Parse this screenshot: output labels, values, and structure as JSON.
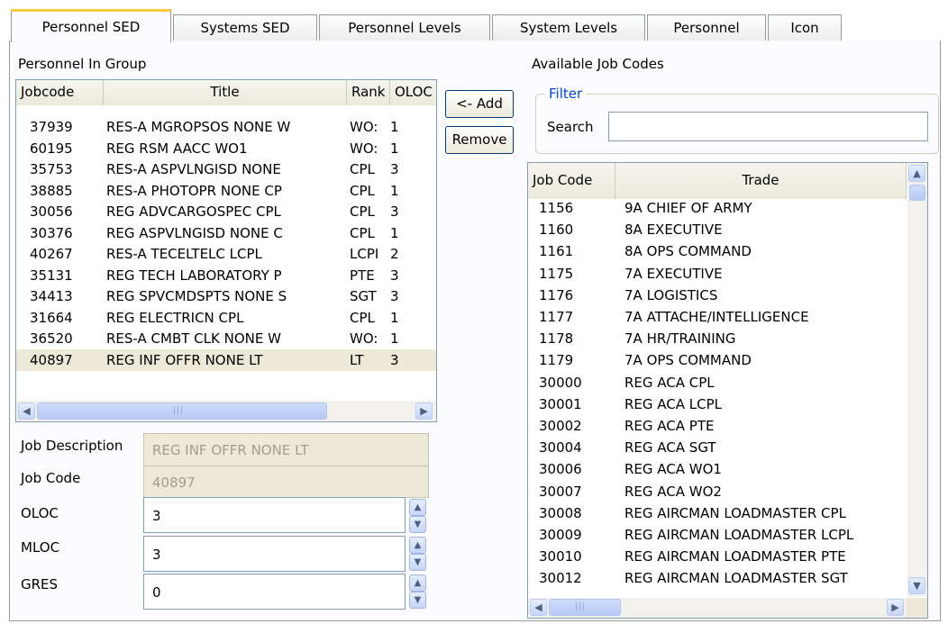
{
  "tabs": [
    {
      "label": "Personnel SED"
    },
    {
      "label": "Systems SED"
    },
    {
      "label": "Personnel Levels"
    },
    {
      "label": "System Levels"
    },
    {
      "label": "Personnel"
    },
    {
      "label": "Icon"
    }
  ],
  "personnel_group": {
    "label": "Personnel In Group",
    "columns": {
      "jobcode": "Jobcode",
      "title": "Title",
      "rank": "Rank",
      "oloc": "OLOC"
    },
    "rows": [
      {
        "jobcode": "37939",
        "title": "RES-A MGROPSOS NONE W",
        "rank": "WO:",
        "oloc": "1"
      },
      {
        "jobcode": "60195",
        "title": "REG RSM AACC WO1",
        "rank": "WO:",
        "oloc": "1"
      },
      {
        "jobcode": "35753",
        "title": "RES-A ASPVLNGISD NONE",
        "rank": "CPL",
        "oloc": "3"
      },
      {
        "jobcode": "38885",
        "title": "RES-A PHOTOPR NONE CP",
        "rank": "CPL",
        "oloc": "1"
      },
      {
        "jobcode": "30056",
        "title": "REG ADVCARGOSPEC CPL",
        "rank": "CPL",
        "oloc": "3"
      },
      {
        "jobcode": "30376",
        "title": "REG ASPVLNGISD NONE C",
        "rank": "CPL",
        "oloc": "1"
      },
      {
        "jobcode": "40267",
        "title": "RES-A TECELTELC LCPL",
        "rank": "LCPI",
        "oloc": "2"
      },
      {
        "jobcode": "35131",
        "title": "REG TECH LABORATORY P",
        "rank": "PTE",
        "oloc": "3"
      },
      {
        "jobcode": "34413",
        "title": "REG SPVCMDSPTS NONE S",
        "rank": "SGT",
        "oloc": "3"
      },
      {
        "jobcode": "31664",
        "title": "REG ELECTRICN CPL",
        "rank": "CPL",
        "oloc": "1"
      },
      {
        "jobcode": "36520",
        "title": "RES-A CMBT CLK NONE W",
        "rank": "WO:",
        "oloc": "1"
      },
      {
        "jobcode": "40897",
        "title": "REG INF OFFR NONE LT",
        "rank": "LT",
        "oloc": "3"
      }
    ],
    "selected_index": 11
  },
  "buttons": {
    "add": "<- Add",
    "remove": "Remove"
  },
  "details": {
    "job_description": {
      "label": "Job Description",
      "value": "REG INF OFFR NONE LT"
    },
    "job_code": {
      "label": "Job Code",
      "value": "40897"
    },
    "oloc": {
      "label": "OLOC",
      "value": "3"
    },
    "mloc": {
      "label": "MLOC",
      "value": "3"
    },
    "gres": {
      "label": "GRES",
      "value": "0"
    }
  },
  "available": {
    "label": "Available Job Codes",
    "filter": {
      "legend": "Filter",
      "search_label": "Search",
      "search_value": ""
    },
    "columns": {
      "job_code": "Job Code",
      "trade": "Trade"
    },
    "rows": [
      {
        "job_code": "1156",
        "trade": "9A CHIEF OF ARMY"
      },
      {
        "job_code": "1160",
        "trade": "8A EXECUTIVE"
      },
      {
        "job_code": "1161",
        "trade": "8A OPS COMMAND"
      },
      {
        "job_code": "1175",
        "trade": "7A EXECUTIVE"
      },
      {
        "job_code": "1176",
        "trade": "7A LOGISTICS"
      },
      {
        "job_code": "1177",
        "trade": "7A ATTACHE/INTELLIGENCE"
      },
      {
        "job_code": "1178",
        "trade": "7A HR/TRAINING"
      },
      {
        "job_code": "1179",
        "trade": "7A OPS COMMAND"
      },
      {
        "job_code": "30000",
        "trade": "REG ACA CPL"
      },
      {
        "job_code": "30001",
        "trade": "REG ACA LCPL"
      },
      {
        "job_code": "30002",
        "trade": "REG ACA PTE"
      },
      {
        "job_code": "30004",
        "trade": "REG ACA SGT"
      },
      {
        "job_code": "30006",
        "trade": "REG ACA WO1"
      },
      {
        "job_code": "30007",
        "trade": "REG ACA WO2"
      },
      {
        "job_code": "30008",
        "trade": "REG AIRCMAN LOADMASTER CPL"
      },
      {
        "job_code": "30009",
        "trade": "REG AIRCMAN LOADMASTER LCPL"
      },
      {
        "job_code": "30010",
        "trade": "REG AIRCMAN LOADMASTER PTE"
      },
      {
        "job_code": "30012",
        "trade": "REG AIRCMAN LOADMASTER SGT"
      }
    ]
  },
  "icons": {
    "scroll_left": "chevron-left-icon",
    "scroll_right": "chevron-right-icon",
    "scroll_up": "chevron-up-icon",
    "scroll_down": "chevron-down-icon"
  },
  "colors": {
    "active_tab_accent": "#ffc83c",
    "selection": "#ece9d8",
    "filter_legend": "#0046d5",
    "scrollbar": "#c6d6f7"
  }
}
